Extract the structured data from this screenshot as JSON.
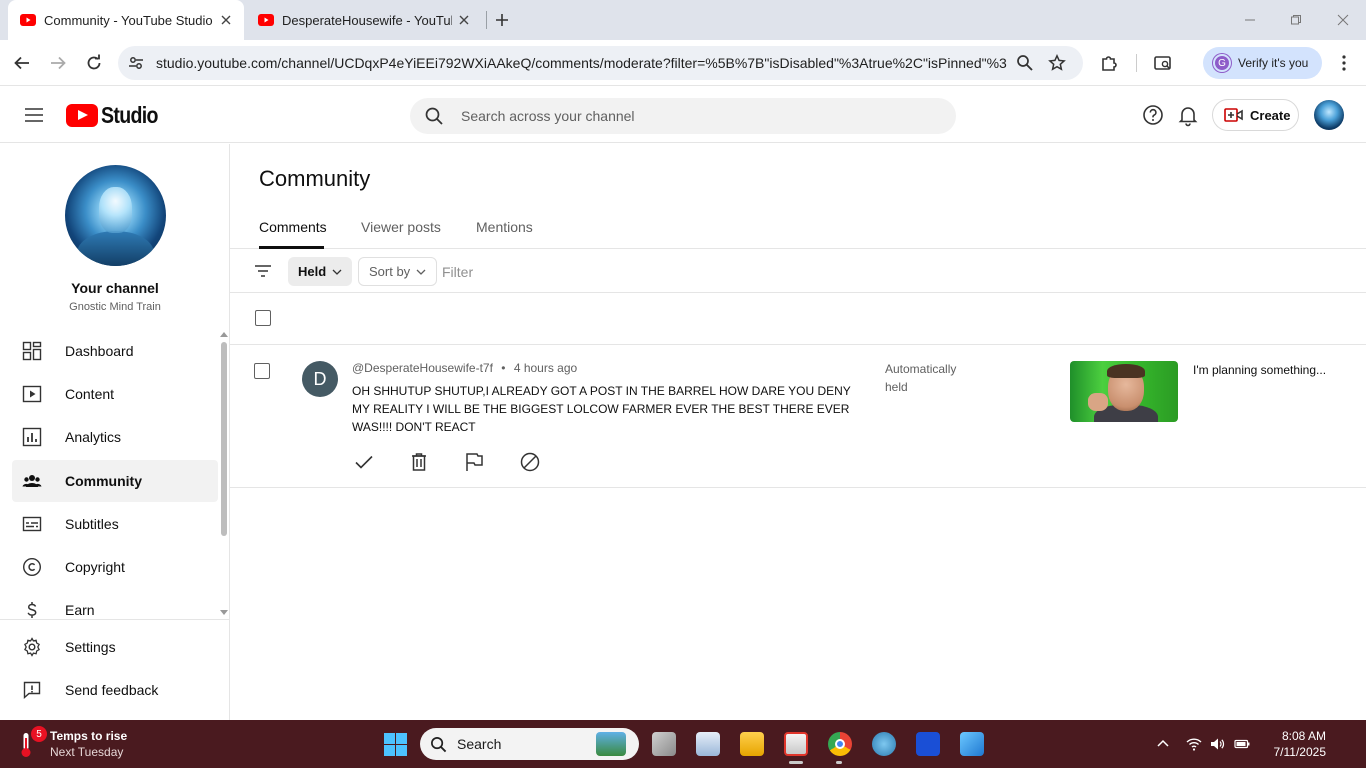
{
  "browser": {
    "tabs": [
      {
        "title": "Community - YouTube Studio",
        "active": true
      },
      {
        "title": "DesperateHousewife - YouTube",
        "active": false
      }
    ],
    "url": "studio.youtube.com/channel/UCDqxP4eYiEEi792WXiAAkeQ/comments/moderate?filter=%5B%7B\"isDisabled\"%3Atrue%2C\"isPinned\"%3...",
    "verify_label": "Verify it's you",
    "verify_avatar_letter": "G"
  },
  "studio": {
    "logo_text": "Studio",
    "search_placeholder": "Search across your channel",
    "create_label": "Create"
  },
  "sidebar": {
    "your_channel": "Your channel",
    "channel_name": "Gnostic Mind Train",
    "items": [
      {
        "label": "Dashboard",
        "icon": "dashboard-icon"
      },
      {
        "label": "Content",
        "icon": "content-icon"
      },
      {
        "label": "Analytics",
        "icon": "analytics-icon"
      },
      {
        "label": "Community",
        "icon": "community-icon",
        "selected": true
      },
      {
        "label": "Subtitles",
        "icon": "subtitles-icon"
      },
      {
        "label": "Copyright",
        "icon": "copyright-icon"
      },
      {
        "label": "Earn",
        "icon": "earn-icon"
      }
    ],
    "bottom": [
      {
        "label": "Settings",
        "icon": "gear-icon"
      },
      {
        "label": "Send feedback",
        "icon": "feedback-icon"
      }
    ]
  },
  "main": {
    "title": "Community",
    "tabs": [
      "Comments",
      "Viewer posts",
      "Mentions"
    ],
    "active_tab": "Comments",
    "filters": {
      "held_chip": "Held",
      "sort_chip": "Sort by",
      "filter_placeholder": "Filter"
    },
    "comments": [
      {
        "avatar_letter": "D",
        "author": "@DesperateHousewife-t7f",
        "separator": "•",
        "time": "4 hours ago",
        "text": "OH SHHUTUP SHUTUP,I ALREADY GOT A POST IN THE BARREL HOW DARE YOU DENY MY REALITY I WILL BE THE BIGGEST LOLCOW FARMER EVER THE BEST THERE EVER WAS!!!! DON'T REACT",
        "status": "Automatically held",
        "video_title": "I'm planning something..."
      }
    ]
  },
  "taskbar": {
    "weather_badge": "5",
    "weather_line1": "Temps to rise",
    "weather_line2": "Next Tuesday",
    "search_label": "Search",
    "time": "8:08 AM",
    "date": "7/11/2025"
  },
  "colors": {
    "youtube_red": "#ff0000",
    "taskbar_bg": "#4a1a1f",
    "verify_bg": "#d3e3fd"
  }
}
